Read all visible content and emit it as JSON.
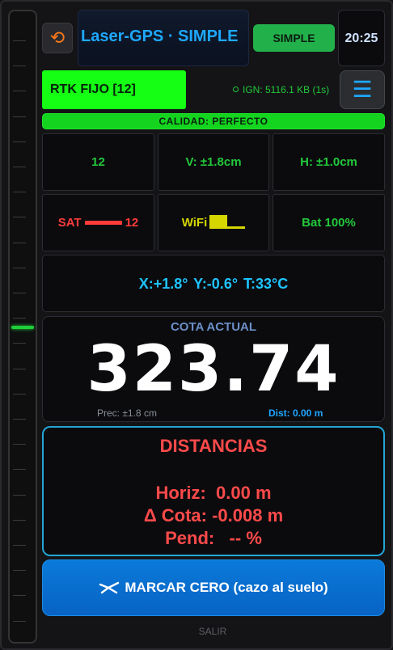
{
  "header": {
    "title": "Laser-GPS · SIMPLE",
    "mode_label": "SIMPLE",
    "clock": "20:25",
    "reset_icon": "refresh-icon",
    "accent": "#1ea8ff"
  },
  "status": {
    "rtk_label": "RTK FIJO [12]",
    "ign_text": "IGN: 5116.1 KB (1s)",
    "quality": "CALIDAD: PERFECTO",
    "menu_icon": "hamburger-menu-icon"
  },
  "grid": {
    "sats_count": "12",
    "v_precision": "V: ±1.8cm",
    "h_precision": "H: ±1.0cm",
    "sat_label": "SAT",
    "sat_value": "12",
    "wifi_label": "WiFi",
    "battery": "Bat 100%"
  },
  "tilt": {
    "text": "X:+1.8°  Y:-0.6°  T:33°C"
  },
  "cota": {
    "label": "COTA ACTUAL",
    "value": "323.74",
    "precision": "Prec: ±1.8 cm",
    "distance": "Dist: 0.00 m"
  },
  "distancias": {
    "title": "DISTANCIAS",
    "horiz": "Horiz:  0.00 m",
    "delta_cota": "Δ Cota: -0.008 m",
    "pend": "Pend:   -- %"
  },
  "actions": {
    "marcar_label": "MARCAR CERO (cazo al suelo)",
    "salir_label": "SALIR"
  },
  "colors": {
    "rtk_fixed": "#14ff14",
    "quality_bar": "#14d41f",
    "distance_border": "#23a6d5",
    "marcar_button": "#0a7ad9"
  }
}
